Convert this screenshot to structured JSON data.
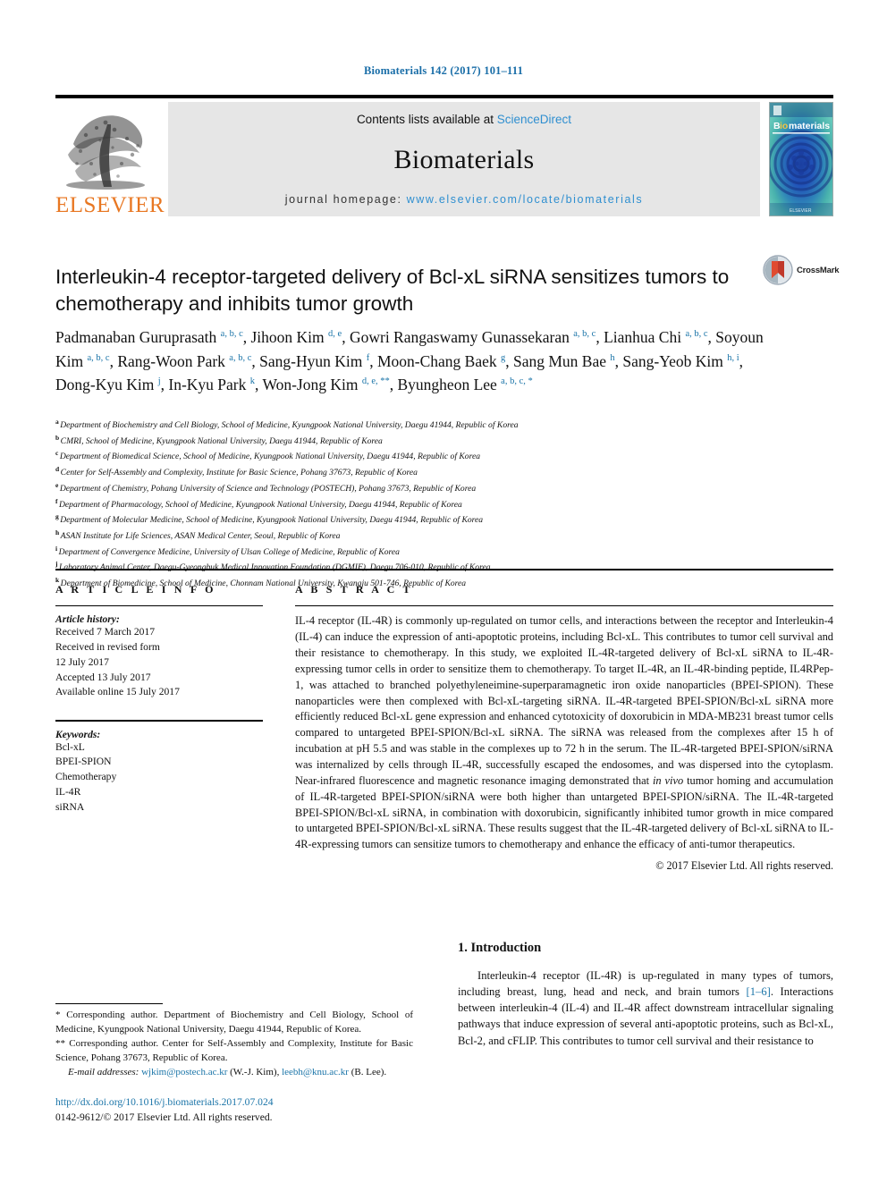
{
  "running_head": "Biomaterials 142 (2017) 101–111",
  "masthead": {
    "contents_prefix": "Contents lists available at ",
    "contents_link": "ScienceDirect",
    "journal_title": "Biomaterials",
    "homepage_prefix": "journal homepage: ",
    "homepage_url": "www.elsevier.com/locate/biomaterials",
    "publisher_logo_text": "ELSEVIER",
    "publisher_logo_icon": "elsevier-tree-icon",
    "cover_title": "Biomaterials",
    "accent_blue": "#2f8fd0",
    "elsevier_orange": "#E87722",
    "band_gray": "#e6e6e6"
  },
  "article": {
    "title": "Interleukin-4 receptor-targeted delivery of Bcl-xL siRNA sensitizes tumors to chemotherapy and inhibits tumor growth",
    "crossmark_label": "CrossMark",
    "crossmark_icon": "crossmark-badge-icon"
  },
  "authors": [
    {
      "name": "Padmanaban Guruprasath",
      "marks": "a, b, c",
      "sep": ", "
    },
    {
      "name": "Jihoon Kim",
      "marks": "d, e",
      "sep": ", "
    },
    {
      "name": "Gowri Rangaswamy Gunassekaran",
      "marks": "a, b, c",
      "sep": ", "
    },
    {
      "name": "Lianhua Chi",
      "marks": "a, b, c",
      "sep": ", "
    },
    {
      "name": "Soyoun Kim",
      "marks": "a, b, c",
      "sep": ", "
    },
    {
      "name": "Rang-Woon Park",
      "marks": "a, b, c",
      "sep": ", "
    },
    {
      "name": "Sang-Hyun Kim",
      "marks": "f",
      "sep": ", "
    },
    {
      "name": "Moon-Chang Baek",
      "marks": "g",
      "sep": ", "
    },
    {
      "name": "Sang Mun Bae",
      "marks": "h",
      "sep": ", "
    },
    {
      "name": "Sang-Yeob Kim",
      "marks": "h, i",
      "sep": ", "
    },
    {
      "name": "Dong-Kyu Kim",
      "marks": "j",
      "sep": ", "
    },
    {
      "name": "In-Kyu Park",
      "marks": "k",
      "sep": ", "
    },
    {
      "name": "Won-Jong Kim",
      "marks": "d, e, **",
      "sep": ", "
    },
    {
      "name": "Byungheon Lee",
      "marks": "a, b, c, *",
      "sep": ""
    }
  ],
  "affiliations": [
    {
      "mark": "a",
      "text": "Department of Biochemistry and Cell Biology, School of Medicine, Kyungpook National University, Daegu 41944, Republic of Korea"
    },
    {
      "mark": "b",
      "text": "CMRI, School of Medicine, Kyungpook National University, Daegu 41944, Republic of Korea"
    },
    {
      "mark": "c",
      "text": "Department of Biomedical Science, School of Medicine, Kyungpook National University, Daegu 41944, Republic of Korea"
    },
    {
      "mark": "d",
      "text": "Center for Self-Assembly and Complexity, Institute for Basic Science, Pohang 37673, Republic of Korea"
    },
    {
      "mark": "e",
      "text": "Department of Chemistry, Pohang University of Science and Technology (POSTECH), Pohang 37673, Republic of Korea"
    },
    {
      "mark": "f",
      "text": "Department of Pharmacology, School of Medicine, Kyungpook National University, Daegu 41944, Republic of Korea"
    },
    {
      "mark": "g",
      "text": "Department of Molecular Medicine, School of Medicine, Kyungpook National University, Daegu 41944, Republic of Korea"
    },
    {
      "mark": "h",
      "text": "ASAN Institute for Life Sciences, ASAN Medical Center, Seoul, Republic of Korea"
    },
    {
      "mark": "i",
      "text": "Department of Convergence Medicine, University of Ulsan College of Medicine, Republic of Korea"
    },
    {
      "mark": "j",
      "text": "Laboratory Animal Center, Daegu-Gyeongbuk Medical Innovation Foundation (DGMIF), Daegu 706-010, Republic of Korea"
    },
    {
      "mark": "k",
      "text": "Department of Biomedicine, School of Medicine, Chonnam National University, Kwangju 501-746, Republic of Korea"
    }
  ],
  "article_info": {
    "heading": "A R T I C L E   I N F O",
    "history_label": "Article history:",
    "history_lines": [
      "Received 7 March 2017",
      "Received in revised form",
      "12 July 2017",
      "Accepted 13 July 2017",
      "Available online 15 July 2017"
    ],
    "keywords_label": "Keywords:",
    "keywords": [
      "Bcl-xL",
      "BPEI-SPION",
      "Chemotherapy",
      "IL-4R",
      "siRNA"
    ]
  },
  "abstract": {
    "heading": "A B S T R A C T",
    "paragraph_part1": "IL-4 receptor (IL-4R) is commonly up-regulated on tumor cells, and interactions between the receptor and Interleukin-4 (IL-4) can induce the expression of anti-apoptotic proteins, including Bcl-xL. This contributes to tumor cell survival and their resistance to chemotherapy. In this study, we exploited IL-4R-targeted delivery of Bcl-xL siRNA to IL-4R-expressing tumor cells in order to sensitize them to chemotherapy. To target IL-4R, an IL-4R-binding peptide, IL4RPep-1, was attached to branched polyethyleneimine-superparamagnetic iron oxide nanoparticles (BPEI-SPION). These nanoparticles were then complexed with Bcl-xL-targeting siRNA. IL-4R-targeted BPEI-SPION/Bcl-xL siRNA more efficiently reduced Bcl-xL gene expression and enhanced cytotoxicity of doxorubicin in MDA-MB231 breast tumor cells compared to untargeted BPEI-SPION/Bcl-xL siRNA. The siRNA was released from the complexes after 15 h of incubation at pH 5.5 and was stable in the complexes up to 72 h in the serum. The IL-4R-targeted BPEI-SPION/siRNA was internalized by cells through IL-4R, successfully escaped the endosomes, and was dispersed into the cytoplasm. Near-infrared fluorescence and magnetic resonance imaging demonstrated that ",
    "italic_phrase": "in vivo",
    "paragraph_part2": " tumor homing and accumulation of IL-4R-targeted BPEI-SPION/siRNA were both higher than untargeted BPEI-SPION/siRNA. The IL-4R-targeted BPEI-SPION/Bcl-xL siRNA, in combination with doxorubicin, significantly inhibited tumor growth in mice compared to untargeted BPEI-SPION/Bcl-xL siRNA. These results suggest that the IL-4R-targeted delivery of Bcl-xL siRNA to IL-4R-expressing tumors can sensitize tumors to chemotherapy and enhance the efficacy of anti-tumor therapeutics.",
    "copyright": "© 2017 Elsevier Ltd. All rights reserved."
  },
  "introduction": {
    "heading": "1.  Introduction",
    "text_before_ref": "Interleukin-4 receptor (IL-4R) is up-regulated in many types of tumors, including breast, lung, head and neck, and brain tumors ",
    "reference": "[1–6]",
    "text_after_ref": ". Interactions between interleukin-4 (IL-4) and IL-4R affect downstream intracellular signaling pathways that induce expression of several anti-apoptotic proteins, such as Bcl-xL, Bcl-2, and cFLIP. This contributes to tumor cell survival and their resistance to"
  },
  "footnotes": {
    "corresponding_1": "Corresponding author. Department of Biochemistry and Cell Biology, School of Medicine, Kyungpook National University, Daegu 41944, Republic of Korea.",
    "corresponding_1_mark": "*",
    "corresponding_2": "Corresponding author. Center for Self-Assembly and Complexity, Institute for Basic Science, Pohang 37673, Republic of Korea.",
    "corresponding_2_mark": "**",
    "email_label": "E-mail addresses:",
    "email_1": "wjkim@postech.ac.kr",
    "email_1_owner": " (W.-J. Kim), ",
    "email_2": "leebh@knu.ac.kr",
    "email_2_owner": " (B. Lee)."
  },
  "doi_block": {
    "doi": "http://dx.doi.org/10.1016/j.biomaterials.2017.07.024",
    "issn": "0142-9612/© 2017 Elsevier Ltd. All rights reserved."
  }
}
